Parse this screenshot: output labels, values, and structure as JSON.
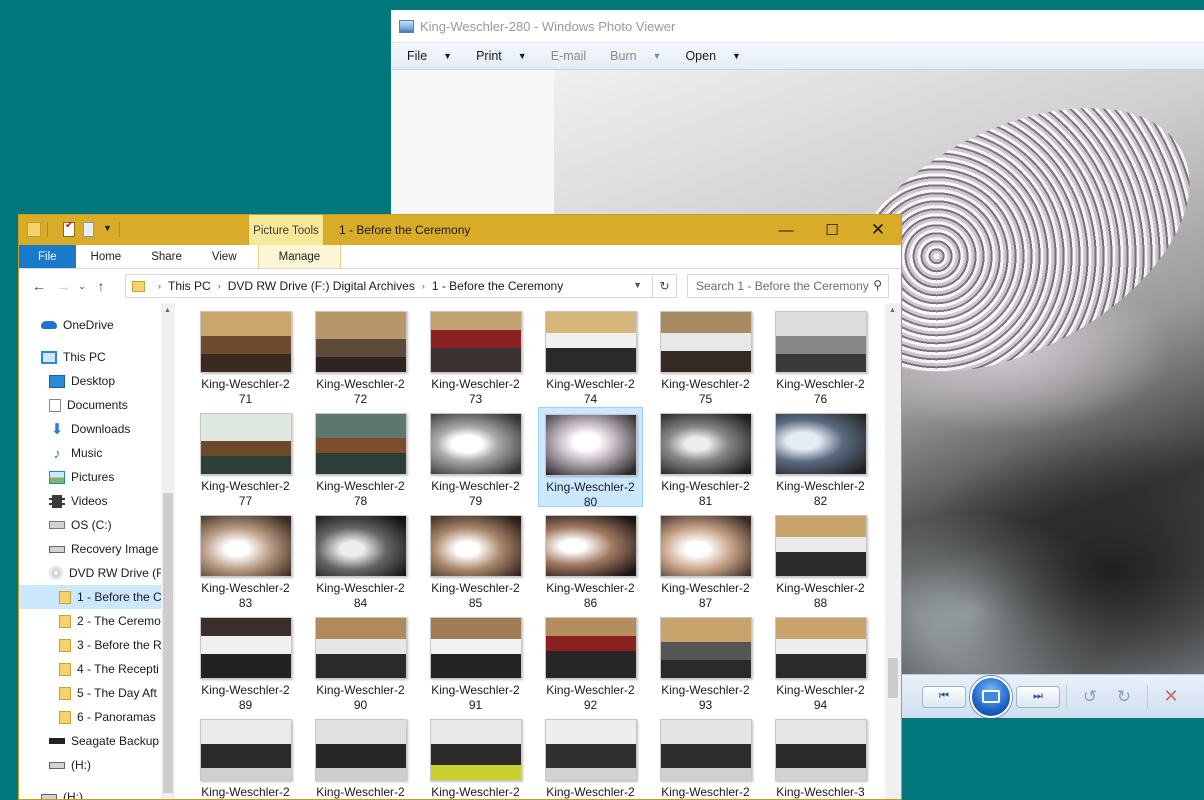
{
  "photo_viewer": {
    "title": "King-Weschler-280 - Windows Photo Viewer",
    "menu": [
      {
        "label": "File",
        "enabled": true,
        "dropdown": true
      },
      {
        "label": "Print",
        "enabled": true,
        "dropdown": true
      },
      {
        "label": "E-mail",
        "enabled": false,
        "dropdown": false
      },
      {
        "label": "Burn",
        "enabled": false,
        "dropdown": true
      },
      {
        "label": "Open",
        "enabled": true,
        "dropdown": true
      }
    ],
    "controls": {
      "previous": "⏮",
      "next": "⏭",
      "rotate_left": "↺",
      "rotate_right": "↻",
      "delete": "✕"
    }
  },
  "explorer": {
    "context_tab": "Picture Tools",
    "title": "1 - Before the Ceremony",
    "window_buttons": {
      "minimize": "—",
      "maximize": "☐",
      "close": "✕"
    },
    "ribbon_tabs": [
      "File",
      "Home",
      "Share",
      "View",
      "Manage"
    ],
    "address": {
      "crumbs": [
        "This PC",
        "DVD RW Drive (F:) Digital Archives",
        "1 - Before the Ceremony"
      ]
    },
    "search": {
      "placeholder": "Search 1 - Before the Ceremony"
    },
    "nav_pane": [
      {
        "label": "OneDrive",
        "icon": "onedrive-icon"
      },
      {
        "label": "This PC",
        "icon": "this-pc-icon"
      },
      {
        "label": "Desktop",
        "icon": "desktop-icon"
      },
      {
        "label": "Documents",
        "icon": "documents-icon"
      },
      {
        "label": "Downloads",
        "icon": "downloads-icon"
      },
      {
        "label": "Music",
        "icon": "music-icon"
      },
      {
        "label": "Pictures",
        "icon": "pictures-icon"
      },
      {
        "label": "Videos",
        "icon": "videos-icon"
      },
      {
        "label": "OS (C:)",
        "icon": "os-drive-icon"
      },
      {
        "label": "Recovery Image",
        "icon": "drive-icon"
      },
      {
        "label": "DVD RW Drive (F",
        "icon": "dvd-drive-icon"
      },
      {
        "label": "1 - Before the C",
        "icon": "folder-icon",
        "selected": true
      },
      {
        "label": "2 - The Ceremo",
        "icon": "folder-icon"
      },
      {
        "label": "3 - Before the R",
        "icon": "folder-icon"
      },
      {
        "label": "4 - The Recepti",
        "icon": "folder-icon"
      },
      {
        "label": "5 - The Day Aft",
        "icon": "folder-icon"
      },
      {
        "label": "6 - Panoramas",
        "icon": "folder-icon"
      },
      {
        "label": "Seagate Backup",
        "icon": "seagate-drive-icon"
      },
      {
        "label": "(H:)",
        "icon": "drive-icon"
      },
      {
        "label": "(H:)",
        "icon": "drive-icon"
      }
    ],
    "files": [
      {
        "line1": "King-Weschler-2",
        "line2": "71"
      },
      {
        "line1": "King-Weschler-2",
        "line2": "72"
      },
      {
        "line1": "King-Weschler-2",
        "line2": "73"
      },
      {
        "line1": "King-Weschler-2",
        "line2": "74"
      },
      {
        "line1": "King-Weschler-2",
        "line2": "75"
      },
      {
        "line1": "King-Weschler-2",
        "line2": "76"
      },
      {
        "line1": "King-Weschler-2",
        "line2": "77"
      },
      {
        "line1": "King-Weschler-2",
        "line2": "78"
      },
      {
        "line1": "King-Weschler-2",
        "line2": "79"
      },
      {
        "line1": "King-Weschler-2",
        "line2": "80",
        "selected": true
      },
      {
        "line1": "King-Weschler-2",
        "line2": "81"
      },
      {
        "line1": "King-Weschler-2",
        "line2": "82"
      },
      {
        "line1": "King-Weschler-2",
        "line2": "83"
      },
      {
        "line1": "King-Weschler-2",
        "line2": "84"
      },
      {
        "line1": "King-Weschler-2",
        "line2": "85"
      },
      {
        "line1": "King-Weschler-2",
        "line2": "86"
      },
      {
        "line1": "King-Weschler-2",
        "line2": "87"
      },
      {
        "line1": "King-Weschler-2",
        "line2": "88"
      },
      {
        "line1": "King-Weschler-2",
        "line2": "89"
      },
      {
        "line1": "King-Weschler-2",
        "line2": "90"
      },
      {
        "line1": "King-Weschler-2",
        "line2": "91"
      },
      {
        "line1": "King-Weschler-2",
        "line2": "92"
      },
      {
        "line1": "King-Weschler-2",
        "line2": "93"
      },
      {
        "line1": "King-Weschler-2",
        "line2": "94"
      },
      {
        "line1": "King-Weschler-2",
        "line2": ""
      },
      {
        "line1": "King-Weschler-2",
        "line2": ""
      },
      {
        "line1": "King-Weschler-2",
        "line2": ""
      },
      {
        "line1": "King-Weschler-2",
        "line2": ""
      },
      {
        "line1": "King-Weschler-2",
        "line2": ""
      },
      {
        "line1": "King-Weschler-3",
        "line2": ""
      }
    ]
  }
}
